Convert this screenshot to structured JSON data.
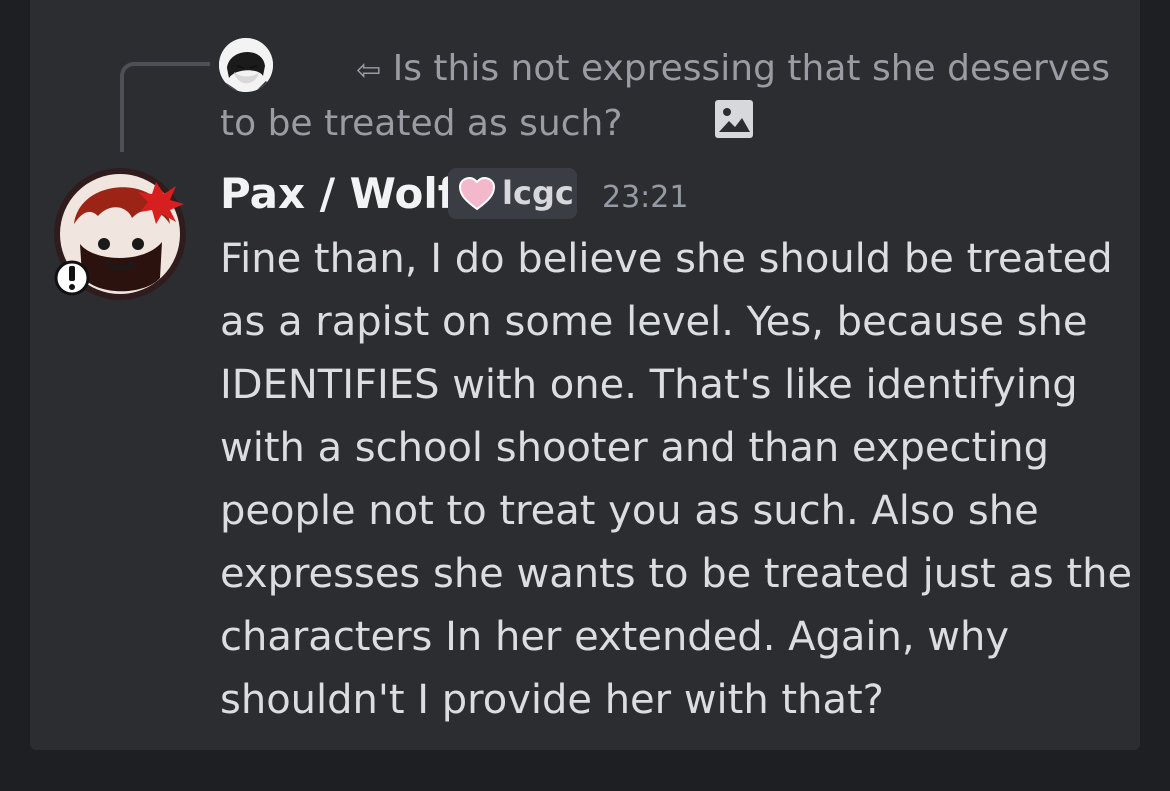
{
  "reply": {
    "icon": "reply-arrow-icon",
    "text": "Is this not expressing that she deserves to be treated as such?",
    "attachment_icon": "image-icon"
  },
  "message": {
    "username": "Pax / Wolf",
    "tag": {
      "icon": "heart-icon",
      "label": "lcgc",
      "color": "#f4b8cc"
    },
    "timestamp": "23:21",
    "body": "Fine than, I do believe she should be treated as a rapist on some level. Yes, because she IDENTIFIES with one. That's like identifying with a school shooter and than expecting people not to treat you as such. Also she expresses she wants to be treated just as the characters In her extended. Again, why shouldn't I provide her with that?"
  },
  "colors": {
    "background": "#1e1f22",
    "panel": "#2b2d31",
    "text": "#dbdee1",
    "muted": "#949ba4"
  }
}
